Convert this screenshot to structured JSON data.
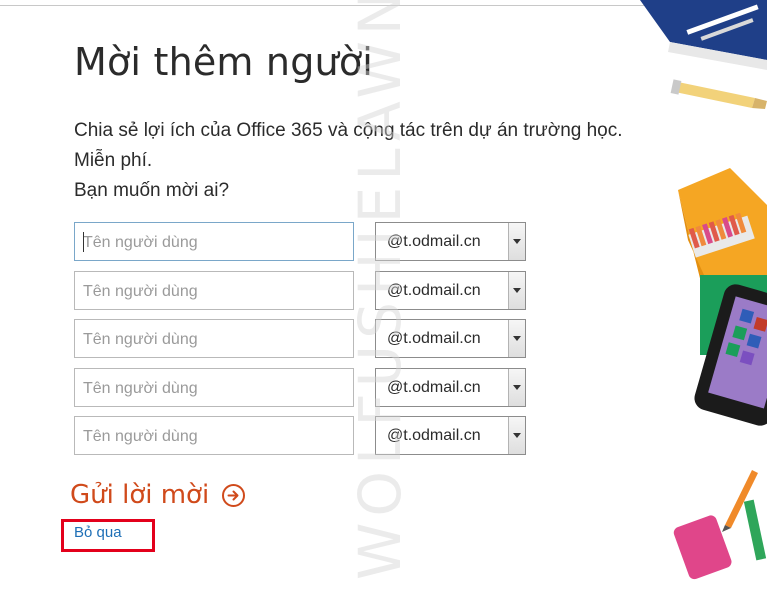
{
  "title": "Mời thêm người",
  "description": {
    "line1": "Chia sẻ lợi ích của Office 365 và cộng tác trên dự án trường học.",
    "line2": "Miễn phí.",
    "line3": "Bạn muốn mời ai?"
  },
  "invite_rows": [
    {
      "placeholder": "Tên người dùng",
      "domain": "@t.odmail.cn"
    },
    {
      "placeholder": "Tên người dùng",
      "domain": "@t.odmail.cn"
    },
    {
      "placeholder": "Tên người dùng",
      "domain": "@t.odmail.cn"
    },
    {
      "placeholder": "Tên người dùng",
      "domain": "@t.odmail.cn"
    },
    {
      "placeholder": "Tên người dùng",
      "domain": "@t.odmail.cn"
    }
  ],
  "actions": {
    "send_label": "Gửi lời mời",
    "skip_label": "Bỏ qua"
  },
  "colors": {
    "accent": "#d04a1b",
    "link": "#1e6fb6",
    "highlight": "#e3001b"
  },
  "icons": {
    "send": "arrow-right-circle-icon",
    "dropdown": "chevron-down-icon"
  }
}
